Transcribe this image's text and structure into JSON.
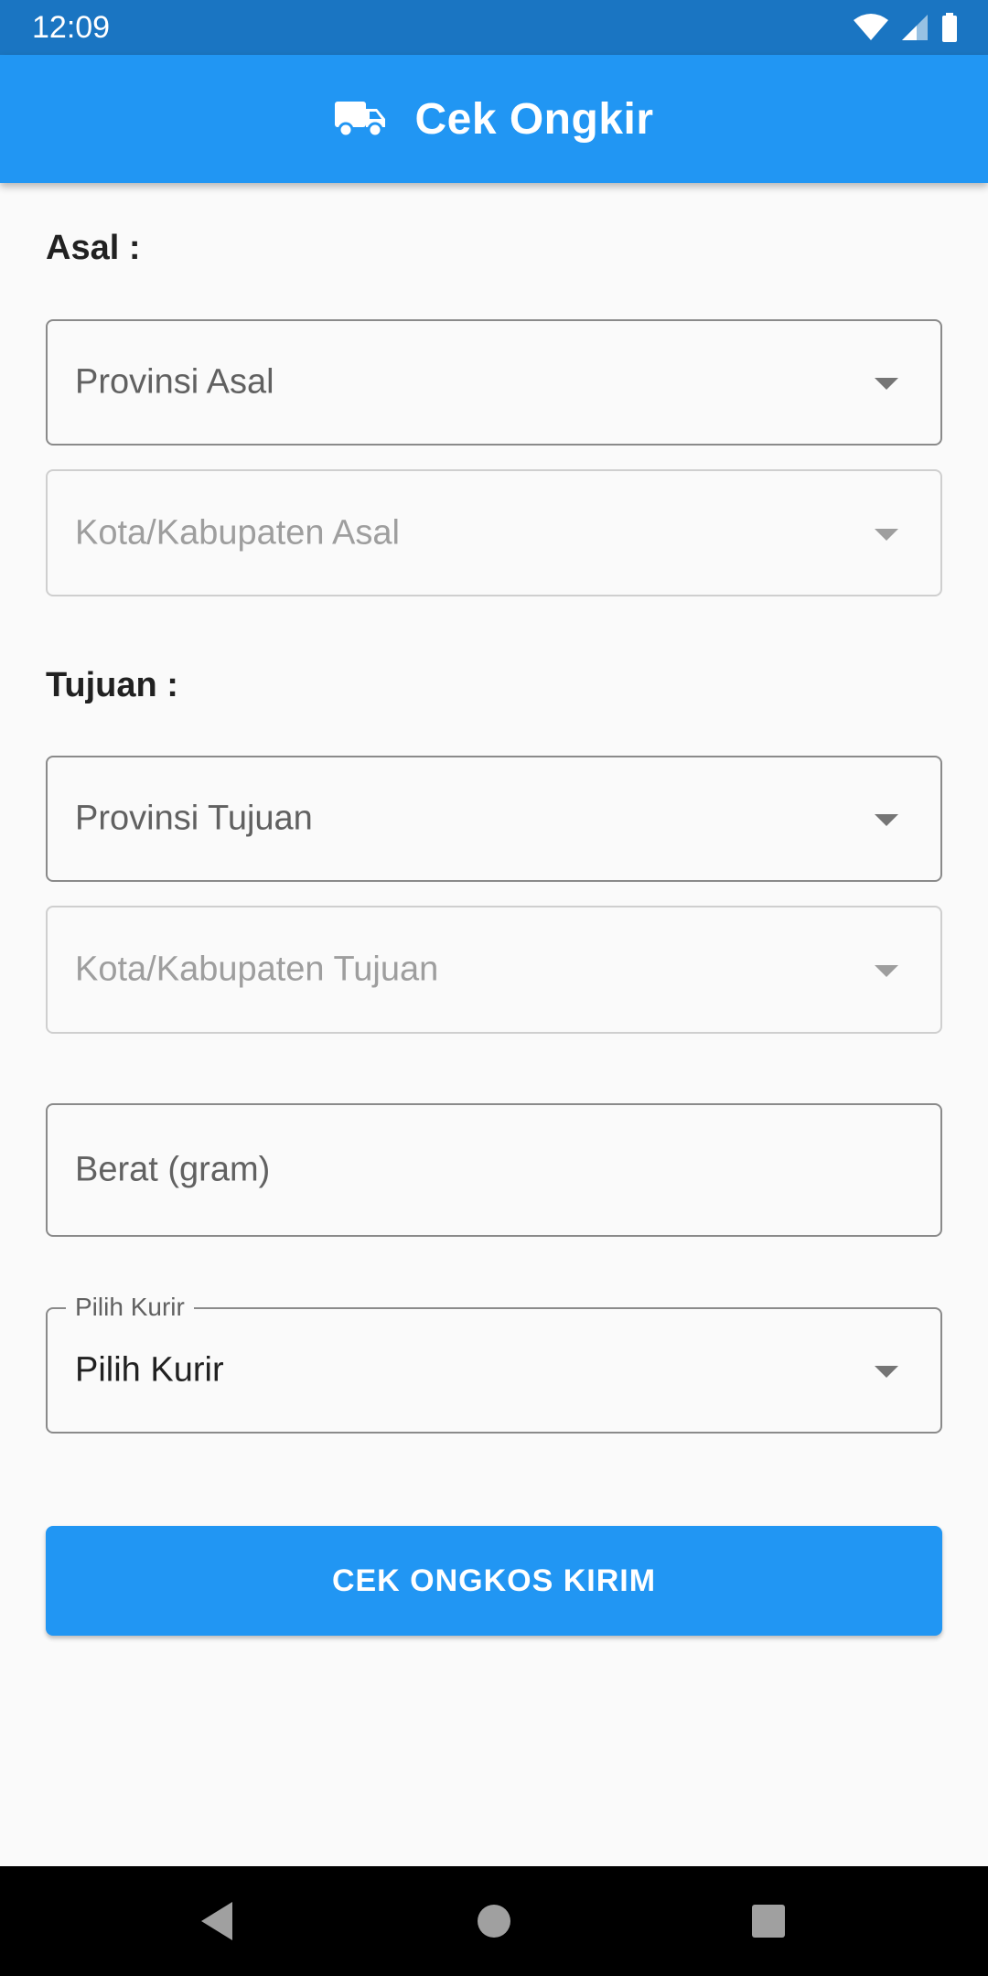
{
  "status_bar": {
    "time": "12:09",
    "icons": [
      "wifi-icon",
      "signal-icon",
      "battery-icon"
    ]
  },
  "app_bar": {
    "title": "Cek Ongkir",
    "icon": "truck-icon"
  },
  "origin": {
    "label": "Asal :",
    "province_placeholder": "Provinsi Asal",
    "city_placeholder": "Kota/Kabupaten Asal"
  },
  "destination": {
    "label": "Tujuan :",
    "province_placeholder": "Provinsi Tujuan",
    "city_placeholder": "Kota/Kabupaten Tujuan"
  },
  "weight": {
    "placeholder": "Berat (gram)"
  },
  "courier": {
    "floating_label": "Pilih Kurir",
    "selected_value": "Pilih Kurir"
  },
  "submit_button": {
    "label": "CEK ONGKOS KIRIM"
  },
  "nav_bar": {
    "icons": [
      "back-icon",
      "home-icon",
      "recents-icon"
    ]
  },
  "colors": {
    "status_bar": "#1a75c2",
    "primary": "#2196f3",
    "background": "#fafafa",
    "nav_bar": "#000000"
  }
}
